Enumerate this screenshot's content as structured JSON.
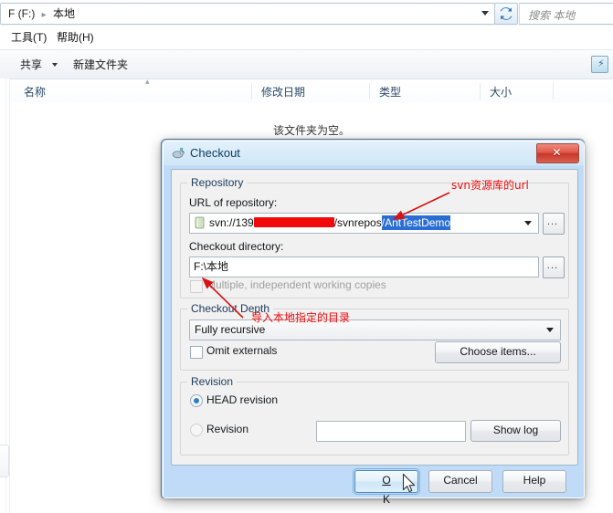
{
  "explorer": {
    "address": {
      "drive": "F (F:)",
      "separator": "▸",
      "current": "本地"
    },
    "refresh_tooltip": "刷新",
    "search": {
      "placeholder": "搜索 本地"
    },
    "menu": [
      {
        "label": "工具(T)"
      },
      {
        "label": "帮助(H)"
      }
    ],
    "commandbar": {
      "share": "共享",
      "new_folder": "新建文件夹",
      "preview_pane_icon": "preview-pane-icon"
    },
    "columns": [
      {
        "label": "名称"
      },
      {
        "label": "修改日期"
      },
      {
        "label": "类型"
      },
      {
        "label": "大小"
      }
    ],
    "empty_message": "该文件夹为空。"
  },
  "dialog": {
    "title": "Checkout",
    "icon": "tortoisesvn-icon",
    "close_label": "✕",
    "repository": {
      "group_label": "Repository",
      "url_label": "URL of repository:",
      "url_prefix": "svn://139",
      "url_redacted": true,
      "url_middle": "/svnrepos",
      "url_selected": "/AntTestDemo",
      "browse_label": "...",
      "dir_label": "Checkout directory:",
      "dir_value": "F:\\本地",
      "dir_browse_label": "...",
      "multiple_wc_label": "Multiple, independent working copies",
      "multiple_wc_checked": false,
      "multiple_wc_disabled": true
    },
    "depth": {
      "group_label": "Checkout Depth",
      "selected": "Fully recursive",
      "omit_externals_label": "Omit externals",
      "omit_externals_checked": false,
      "choose_items_label": "Choose items..."
    },
    "revision": {
      "group_label": "Revision",
      "head_label": "HEAD revision",
      "head_selected": true,
      "revision_label": "Revision",
      "revision_selected": false,
      "revision_value": "",
      "show_log_label": "Show log"
    },
    "buttons": {
      "ok": "OK",
      "ok_mnemonic": "O",
      "ok_rest": "K",
      "cancel": "Cancel",
      "help": "Help"
    }
  },
  "annotations": [
    {
      "text": "svn资源库的url",
      "color": "#f00b0b"
    },
    {
      "text": "导入本地指定的目录",
      "color": "#f00b0b"
    }
  ]
}
